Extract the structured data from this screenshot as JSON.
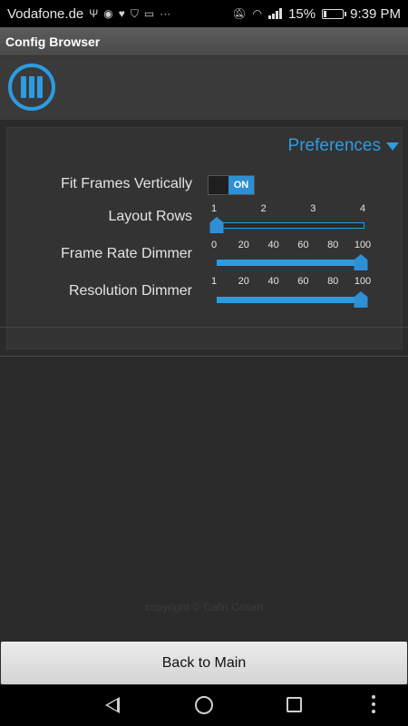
{
  "status_bar": {
    "carrier": "Vodafone.de",
    "battery_percent": "15%",
    "battery_level": 0.15,
    "time": "9:39 PM",
    "icons": [
      "usb-icon",
      "circle-notification-icon",
      "heart-rate-icon",
      "shield-icon",
      "sim-card-icon",
      "more-notifications-icon",
      "mute-icon",
      "wifi-icon",
      "signal-icon",
      "battery-icon"
    ]
  },
  "app_bar": {
    "title": "Config Browser"
  },
  "logo": {
    "icon": "pause-logo-icon",
    "color": "#2d9be0"
  },
  "preferences": {
    "title": "Preferences",
    "fit_frames_vertically": {
      "label": "Fit Frames Vertically",
      "state": "ON"
    },
    "layout_rows": {
      "label": "Layout Rows",
      "ticks": [
        "1",
        "2",
        "3",
        "4"
      ],
      "value": 1
    },
    "frame_rate_dimmer": {
      "label": "Frame Rate Dimmer",
      "ticks": [
        "0",
        "20",
        "40",
        "60",
        "80",
        "100"
      ],
      "value": 100
    },
    "resolution_dimmer": {
      "label": "Resolution Dimmer",
      "ticks": [
        "1",
        "20",
        "40",
        "60",
        "80",
        "100"
      ],
      "value": 100
    }
  },
  "footer": {
    "copyright": "copyright © Calin Crisan"
  },
  "back_button": {
    "label": "Back to Main"
  },
  "nav_bar": {
    "icons": [
      "back-icon",
      "home-icon",
      "recent-apps-icon",
      "overflow-menu-icon"
    ]
  },
  "colors": {
    "accent": "#2d9be0",
    "background": "#2b2b2b",
    "panel": "#333333"
  }
}
